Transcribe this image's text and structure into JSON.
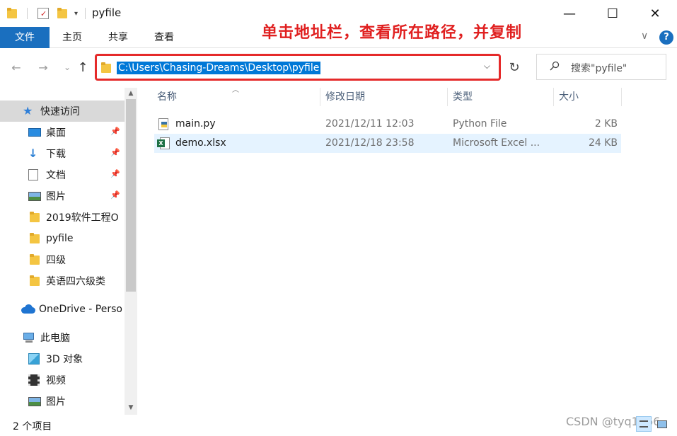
{
  "window": {
    "title": "pyfile",
    "minimize_glyph": "—",
    "maximize_glyph": "☐",
    "close_glyph": "✕"
  },
  "ribbon": {
    "tabs": [
      "文件",
      "主页",
      "共享",
      "查看"
    ],
    "collapse_glyph": "∨",
    "help_glyph": "?"
  },
  "annotation": "单击地址栏，查看所在路径，并复制",
  "address_bar": {
    "path": "C:\\Users\\Chasing-Dreams\\Desktop\\pyfile",
    "dropdown_glyph": "⌵",
    "refresh_glyph": "↻"
  },
  "nav_buttons": {
    "back": "←",
    "forward": "→",
    "recent": "⌄",
    "up": "↑"
  },
  "search": {
    "placeholder": "搜索\"pyfile\""
  },
  "nav_pane": {
    "items": [
      {
        "label": "快速访问",
        "icon": "star-icon",
        "pinned": false
      },
      {
        "label": "桌面",
        "icon": "desktop-icon",
        "pinned": true
      },
      {
        "label": "下载",
        "icon": "download-icon",
        "pinned": true
      },
      {
        "label": "文档",
        "icon": "document-icon",
        "pinned": true
      },
      {
        "label": "图片",
        "icon": "pictures-icon",
        "pinned": true
      },
      {
        "label": "2019软件工程O",
        "icon": "folder-icon",
        "pinned": false
      },
      {
        "label": "pyfile",
        "icon": "folder-icon",
        "pinned": false
      },
      {
        "label": "四级",
        "icon": "folder-icon",
        "pinned": false
      },
      {
        "label": "英语四六级类",
        "icon": "folder-icon",
        "pinned": false
      },
      {
        "label": "OneDrive - Perso",
        "icon": "onedrive-icon",
        "pinned": false
      },
      {
        "label": "此电脑",
        "icon": "computer-icon",
        "pinned": false
      },
      {
        "label": "3D 对象",
        "icon": "3d-objects-icon",
        "pinned": false
      },
      {
        "label": "视频",
        "icon": "video-icon",
        "pinned": false
      },
      {
        "label": "图片",
        "icon": "pictures-icon",
        "pinned": false
      }
    ],
    "pin_glyph": "📌"
  },
  "file_list": {
    "columns": [
      "名称",
      "修改日期",
      "类型",
      "大小"
    ],
    "rows": [
      {
        "name": "main.py",
        "modified": "2021/12/11 12:03",
        "type": "Python File",
        "size": "2 KB",
        "icon": "python-file-icon"
      },
      {
        "name": "demo.xlsx",
        "modified": "2021/12/18 23:58",
        "type": "Microsoft Excel ...",
        "size": "24 KB",
        "icon": "excel-file-icon"
      }
    ]
  },
  "status_bar": {
    "item_count": "2 个项目"
  },
  "watermark": "CSDN @tyq1666",
  "colors": {
    "accent": "#1a6fbf",
    "selection": "#0078d7",
    "annotation_red": "#e02020",
    "row_hover": "#e5f3ff"
  }
}
